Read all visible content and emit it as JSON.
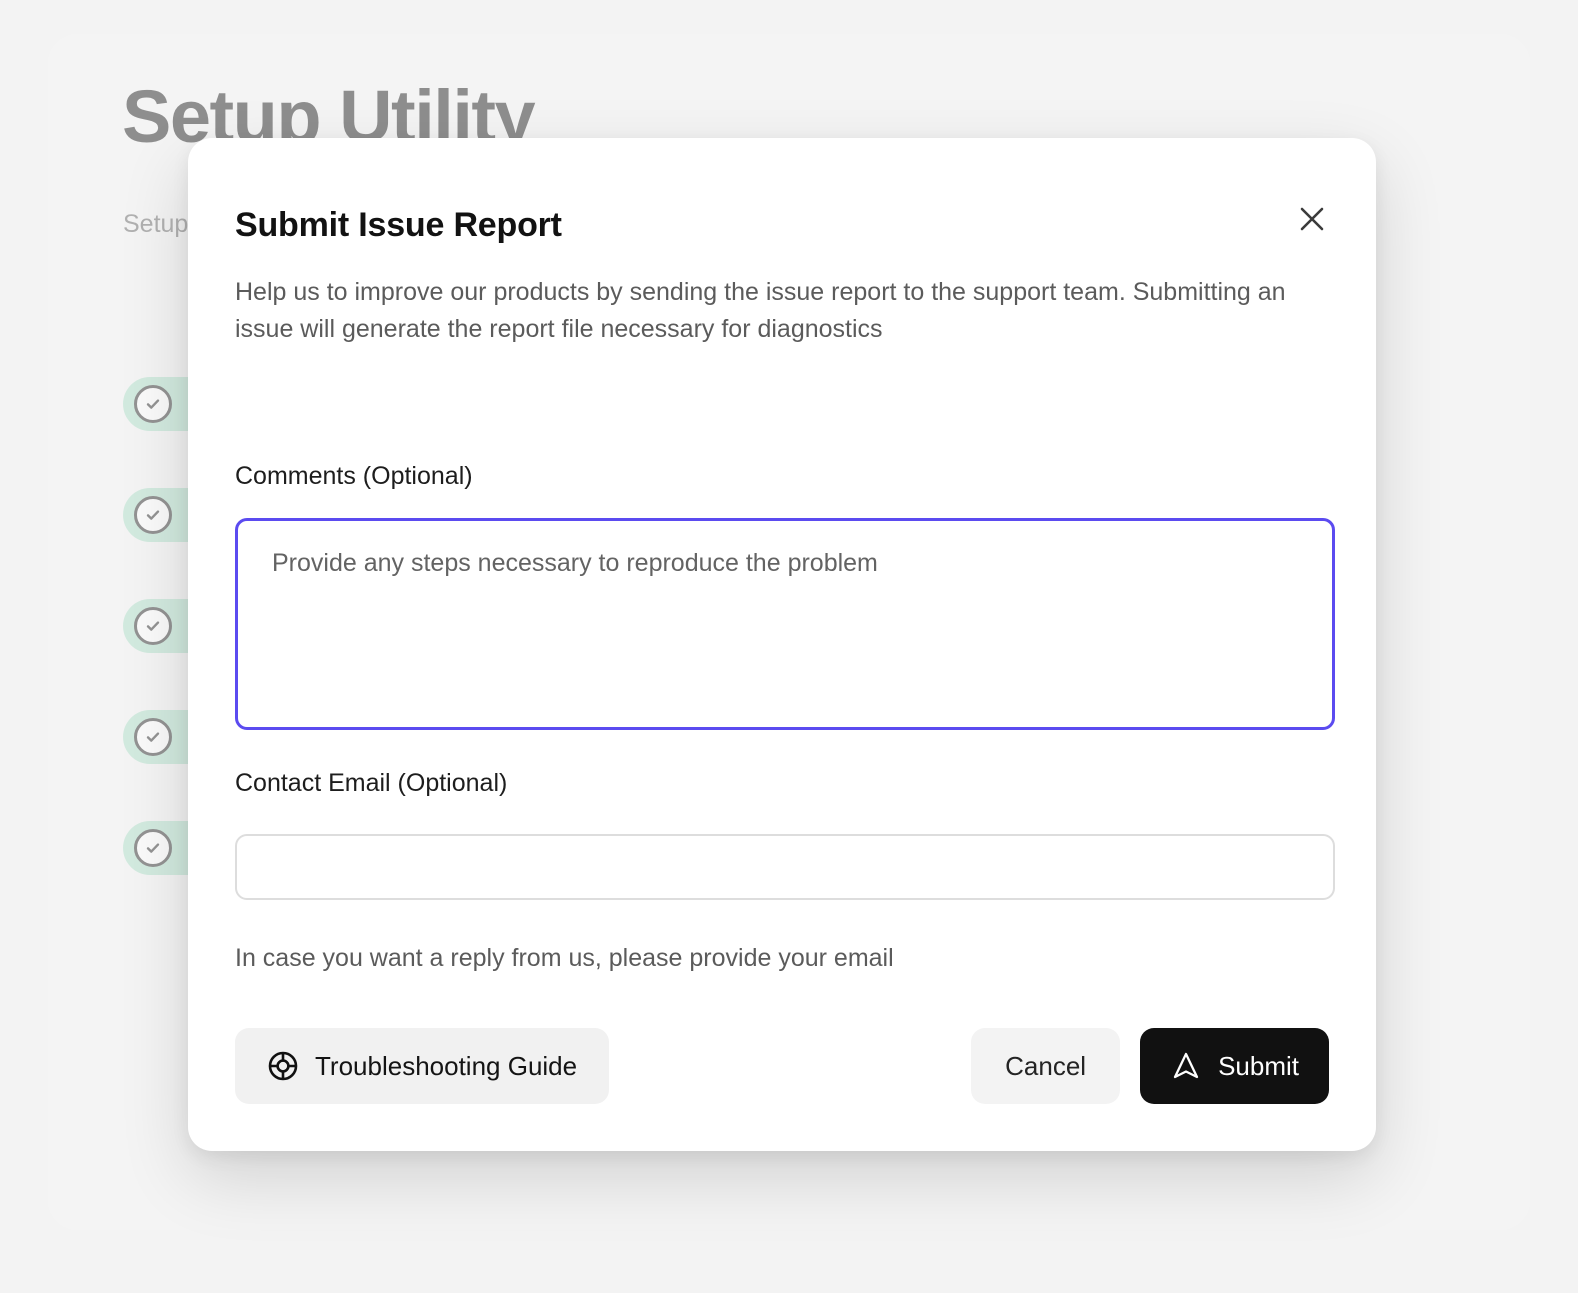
{
  "background": {
    "title": "Setup Utility",
    "subtitle": "Setup                                                                                             t.",
    "checklist": [
      {
        "status_icon": "check-circle-icon",
        "label": ""
      },
      {
        "status_icon": "check-circle-icon",
        "label": ""
      },
      {
        "status_icon": "check-circle-icon",
        "label": ""
      },
      {
        "status_icon": "check-circle-icon",
        "label": ""
      },
      {
        "status_icon": "check-circle-icon",
        "label": ""
      }
    ],
    "pill_color": "#a7dcc4"
  },
  "modal": {
    "title": "Submit Issue Report",
    "close_icon": "close-icon",
    "description": "Help us to improve our products by sending the issue report to the support team. Submitting an issue will generate the report file necessary for diagnostics",
    "comments": {
      "label": "Comments (Optional)",
      "placeholder": "Provide any steps necessary to reproduce the problem",
      "value": "",
      "focus_border_color": "#5b4bf0"
    },
    "email": {
      "label": "Contact Email (Optional)",
      "placeholder": "",
      "value": "",
      "hint": "In case you want a reply from us, please provide your email"
    },
    "footer": {
      "troubleshooting_label": "Troubleshooting Guide",
      "troubleshooting_icon": "lifebuoy-icon",
      "cancel_label": "Cancel",
      "submit_label": "Submit",
      "submit_icon": "navigation-arrow-icon",
      "submit_bg_color": "#111111"
    }
  }
}
